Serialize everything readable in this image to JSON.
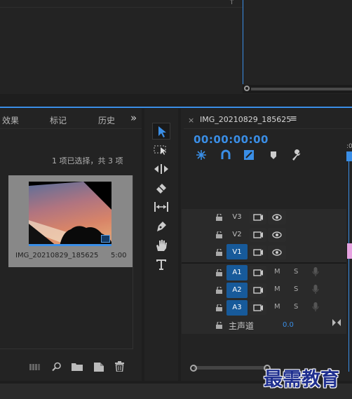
{
  "top_monitor": {
    "scroll_marker": "↑"
  },
  "project": {
    "tabs": [
      "效果",
      "标记",
      "历史"
    ],
    "overflow": "»",
    "selection_status": "1 项已选择，共 3 项",
    "clip": {
      "name": "IMG_20210829_185625",
      "duration": "5:00"
    },
    "bottom_icons": [
      "list-view-icon",
      "search-icon",
      "folder-icon",
      "new-item-icon",
      "trash-icon"
    ]
  },
  "tools": [
    "selection-tool",
    "track-select-tool",
    "ripple-edit-tool",
    "razor-tool",
    "slip-tool",
    "pen-tool",
    "hand-tool",
    "type-tool"
  ],
  "timeline": {
    "close": "×",
    "title": "IMG_20210829_185625",
    "menu": "≡",
    "timecode": "00:00:00:00",
    "ruler_mark": ":0",
    "video_tracks": [
      {
        "name": "V3",
        "active": false
      },
      {
        "name": "V2",
        "active": false
      },
      {
        "name": "V1",
        "active": true
      }
    ],
    "audio_tracks": [
      {
        "name": "A1",
        "m": "M",
        "s": "S"
      },
      {
        "name": "A2",
        "m": "M",
        "s": "S"
      },
      {
        "name": "A3",
        "m": "M",
        "s": "S"
      }
    ],
    "master": {
      "label": "主声道",
      "value": "0.0"
    }
  },
  "watermark": "最需教育",
  "colors": {
    "accent": "#3a8ee6",
    "track_active": "#175a9a",
    "panel": "#232323",
    "watermark": "#1f2f8f"
  }
}
